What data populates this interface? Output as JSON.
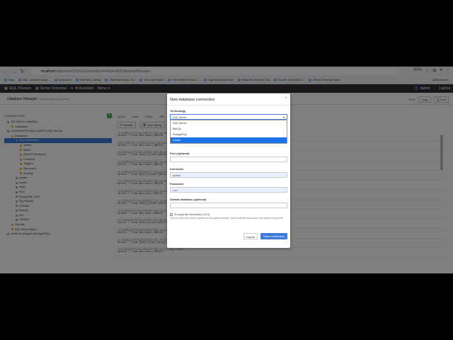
{
  "browser": {
    "url_host": "localhost",
    "url_path": "/sqlpioneer/(S(h3r3Soa0rab0o4r4ftpiwaf))/DatabaseManager",
    "zoom": "90%"
  },
  "bookmarks": [
    "Apps",
    "Mail - chandan.kuman...",
    "Bookmarks",
    "WikiPedia Training",
    "Trademark status - M...",
    "SIKI Data Models",
    "Free Edition's Picks 8 ...",
    "Yoga Body Mind Clean",
    "Business_Services_Tool",
    "Electric_Innovative_V...",
    "School_Running_Guide"
  ],
  "bookmarks_right": "All Bookmarks",
  "appnav": {
    "brand": "SQL Pioneer",
    "server_overview": "Server Overview",
    "ai_assistant": "AI Assistant",
    "menu": "Menu",
    "user": "Admin",
    "logout": "LogOut"
  },
  "titlebar": {
    "title": "Database Manager",
    "subtitle": "Execute queries & browse",
    "theme_label": "Font:",
    "theme_value": "Large",
    "print": "Print"
  },
  "left": {
    "header": "CONNECTIONS",
    "tree": [
      {
        "label": "192.168.10.0 (MySQL)",
        "indent": 4,
        "kind": "db"
      },
      {
        "label": "Databases",
        "indent": 10,
        "kind": "fold"
      },
      {
        "label": "CHANDAN PC\\SQL2016DEV (SQL Server)",
        "indent": 4,
        "kind": "db"
      },
      {
        "label": "Databases",
        "indent": 10,
        "kind": "fold"
      },
      {
        "label": "AdventureWorks",
        "indent": 16,
        "kind": "db",
        "selected": true
      },
      {
        "label": "Tables",
        "indent": 22,
        "kind": "fold"
      },
      {
        "label": "Views",
        "indent": 22,
        "kind": "fold"
      },
      {
        "label": "Stored Procedures",
        "indent": 22,
        "kind": "fold"
      },
      {
        "label": "Functions",
        "indent": 22,
        "kind": "fold"
      },
      {
        "label": "Triggers",
        "indent": 22,
        "kind": "fold"
      },
      {
        "label": "Synonyms",
        "indent": 22,
        "kind": "fold"
      },
      {
        "label": "Security",
        "indent": 22,
        "kind": "fold"
      },
      {
        "label": "master",
        "indent": 16,
        "kind": "db"
      },
      {
        "label": "model",
        "indent": 16,
        "kind": "db"
      },
      {
        "label": "msdb",
        "indent": 16,
        "kind": "db"
      },
      {
        "label": "POC",
        "indent": 16,
        "kind": "db"
      },
      {
        "label": "SampleDB_2016",
        "indent": 16,
        "kind": "db"
      },
      {
        "label": "SQLPioneer",
        "indent": 16,
        "kind": "db"
      },
      {
        "label": "SSISDB",
        "indent": 16,
        "kind": "db"
      },
      {
        "label": "tempdb",
        "indent": 16,
        "kind": "db"
      },
      {
        "label": "test",
        "indent": 16,
        "kind": "db"
      },
      {
        "label": "TIENDB",
        "indent": 16,
        "kind": "db"
      },
      {
        "label": "Security",
        "indent": 10,
        "kind": "fold"
      },
      {
        "label": "SQL Server Agent",
        "indent": 10,
        "kind": "fold"
      },
      {
        "label": "localhost_postgres (PostgreSQL)",
        "indent": 4,
        "kind": "db"
      }
    ]
  },
  "mid": {
    "tabs": [
      "Query",
      "Data",
      "Script",
      "Hist"
    ],
    "toolbar": [
      "Refresh",
      "Clear history"
    ],
    "history": [
      {
        "meta": "on  CHANDAN PC\\SQL2016DEV (SQL Server)  ·  SQL  ·  7 rows",
        "query": "select * from dbo.start_DB1121"
      },
      {
        "meta": "done  CHANDAN PC\\SQL2016DEV (SQL Server)",
        "query": "select * from dbo.start_DB1121"
      },
      {
        "meta": "on  CHANDAN PC\\SQL2016DEV (SQL Server)",
        "query": "select * from [dbo].[start_DB1121]"
      },
      {
        "meta": "on  CHANDAN PC\\SQL2016DEV (SQL Server)",
        "query": "select * from dbo.start_DB1121"
      },
      {
        "meta": "on  CHANDAN PC\\SQL2016DEV (SQL Server)",
        "query": "select * from [dbo].[start_DB1121]"
      },
      {
        "meta": "on  CHANDAN PC\\SQL2016DEV (SQL Server)",
        "query": "select * from dbo.start_DB1121"
      },
      {
        "meta": "on  CHANDAN PC\\SQL2016DEV (SQL Server)",
        "query": "select * from dbo.start_DB1121"
      },
      {
        "meta": "on  CHANDAN PC\\SQL2016DEV (SQL Server)",
        "query": "select * from [dbo].[start_DB1121]"
      },
      {
        "meta": "on  CHANDAN PC\\SQL2016DEV (SQL Server)",
        "query": "select * from dbo.start_DB1121"
      },
      {
        "meta": "on  CHANDAN PC\\SQL2016DEV (SQL Server)",
        "query": "select * from [dbo].[start_DB1121]"
      },
      {
        "meta": "on  CHANDAN PC\\SQL2016DEV (SQL Server)",
        "query": "select * from dbo.start_DB1121"
      },
      {
        "meta": "on  CHANDAN PC\\SQL2016DEV (SQL Server)  ·  SQL  ·  9 rows",
        "query": "select * from [dbo].[ship_range]"
      },
      {
        "meta": "on  CHANDAN PC\\SQL2016DEV (SQL Server)  ·  SQL  ·  4 rows",
        "query": "select * from dbo.start_DB1121"
      }
    ]
  },
  "modal": {
    "title": "New database connection",
    "close": "×",
    "technology_label": "Technology",
    "technology_value": "SQL Server",
    "options": [
      "SQL Server",
      "MySQL",
      "PostgreSQL",
      "Oracle"
    ],
    "active_option": 3,
    "port_label": "Port (optional)",
    "port_value": "",
    "username_label": "Username",
    "username_value": "Admin",
    "password_label": "Password",
    "password_value": "•••••",
    "default_db_label": "Default database (optional)",
    "default_db_value": "",
    "encrypt_label": "Encrypt the connection (TLS)",
    "encrypt_help": "Turn on when the server requires an encrypted channel. Saved with this connection and reused every time.",
    "cancel": "Cancel",
    "save": "Save connection"
  },
  "colors": {
    "primary": "#3e7bd8",
    "navbar": "#2d3136",
    "success": "#4caf50"
  }
}
